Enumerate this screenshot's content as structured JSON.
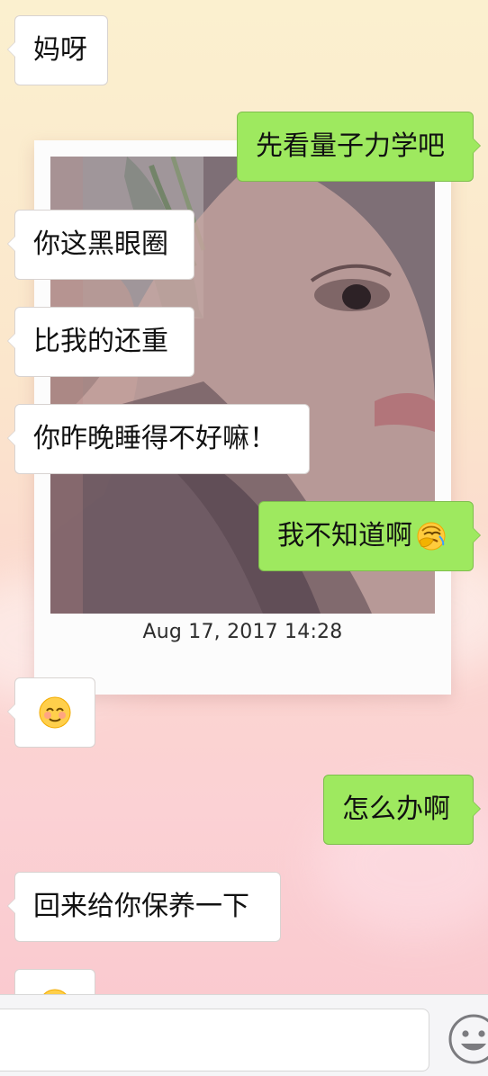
{
  "chat": {
    "messages": [
      {
        "side": "in",
        "text": "妈呀"
      },
      {
        "side": "out",
        "text": "先看量子力学吧"
      },
      {
        "side": "in",
        "text": "你这黑眼圈"
      },
      {
        "side": "in",
        "text": "比我的还重"
      },
      {
        "side": "in",
        "text": "你昨晚睡得不好嘛！"
      },
      {
        "side": "out",
        "text": "我不知道啊",
        "emoji": "face-with-hand-over-eyes-crying"
      },
      {
        "side": "in",
        "emoji": "blushing-smiling-face"
      },
      {
        "side": "out",
        "text": "怎么办啊"
      },
      {
        "side": "in",
        "text": "回来给你保养一下"
      },
      {
        "side": "in",
        "emoji": "smiling-face-partial"
      }
    ]
  },
  "photo_card": {
    "date_text": "Aug 17, 2017 14:28"
  },
  "input_bar": {
    "value": "",
    "placeholder": "",
    "emoji_button_icon": "smiley-face-icon"
  },
  "colors": {
    "incoming_bubble": "#ffffff",
    "outgoing_bubble": "#9ee95f",
    "input_bar_bg": "#f5f5f7"
  }
}
